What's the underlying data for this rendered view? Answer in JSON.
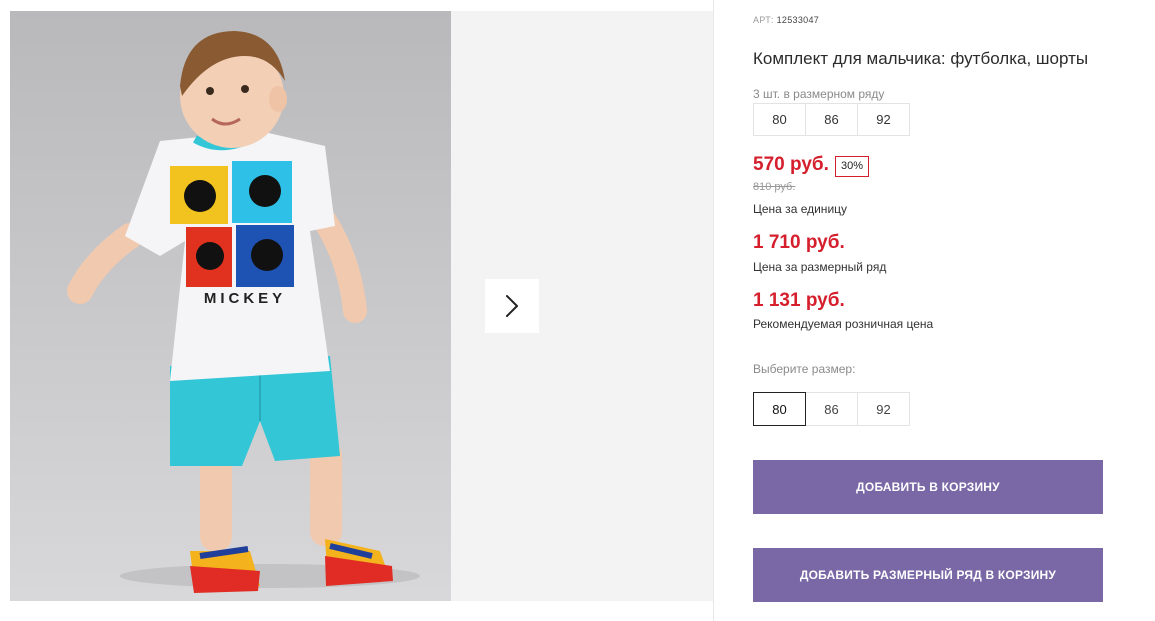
{
  "product": {
    "art_label": "АРТ:",
    "art_number": "12533047",
    "title": "Комплект для мальчика: футболка, шорты",
    "pack_note": "3 шт. в размерном ряду",
    "pack_sizes": [
      "80",
      "86",
      "92"
    ]
  },
  "pricing": {
    "price": "570 руб.",
    "discount": "30%",
    "old_price": "810 руб.",
    "unit_label": "Цена за единицу",
    "row_price": "1 710 руб.",
    "row_label": "Цена за размерный ряд",
    "rrp_price": "1 131 руб.",
    "rrp_label": "Рекомендуемая розничная цена"
  },
  "size_picker": {
    "label": "Выберите размер:",
    "sizes": [
      "80",
      "86",
      "92"
    ],
    "selected": "80"
  },
  "actions": {
    "add_to_cart": "ДОБАВИТЬ В КОРЗИНУ",
    "add_row_to_cart": "ДОБАВИТЬ РАЗМЕРНЫЙ РЯД В КОРЗИНУ"
  },
  "print": {
    "shirt_text": "MICKEY"
  },
  "colors": {
    "accent_price": "#d51f2c",
    "button": "#7a68a6"
  },
  "icons": {
    "gallery_next": "chevron-right-icon"
  }
}
